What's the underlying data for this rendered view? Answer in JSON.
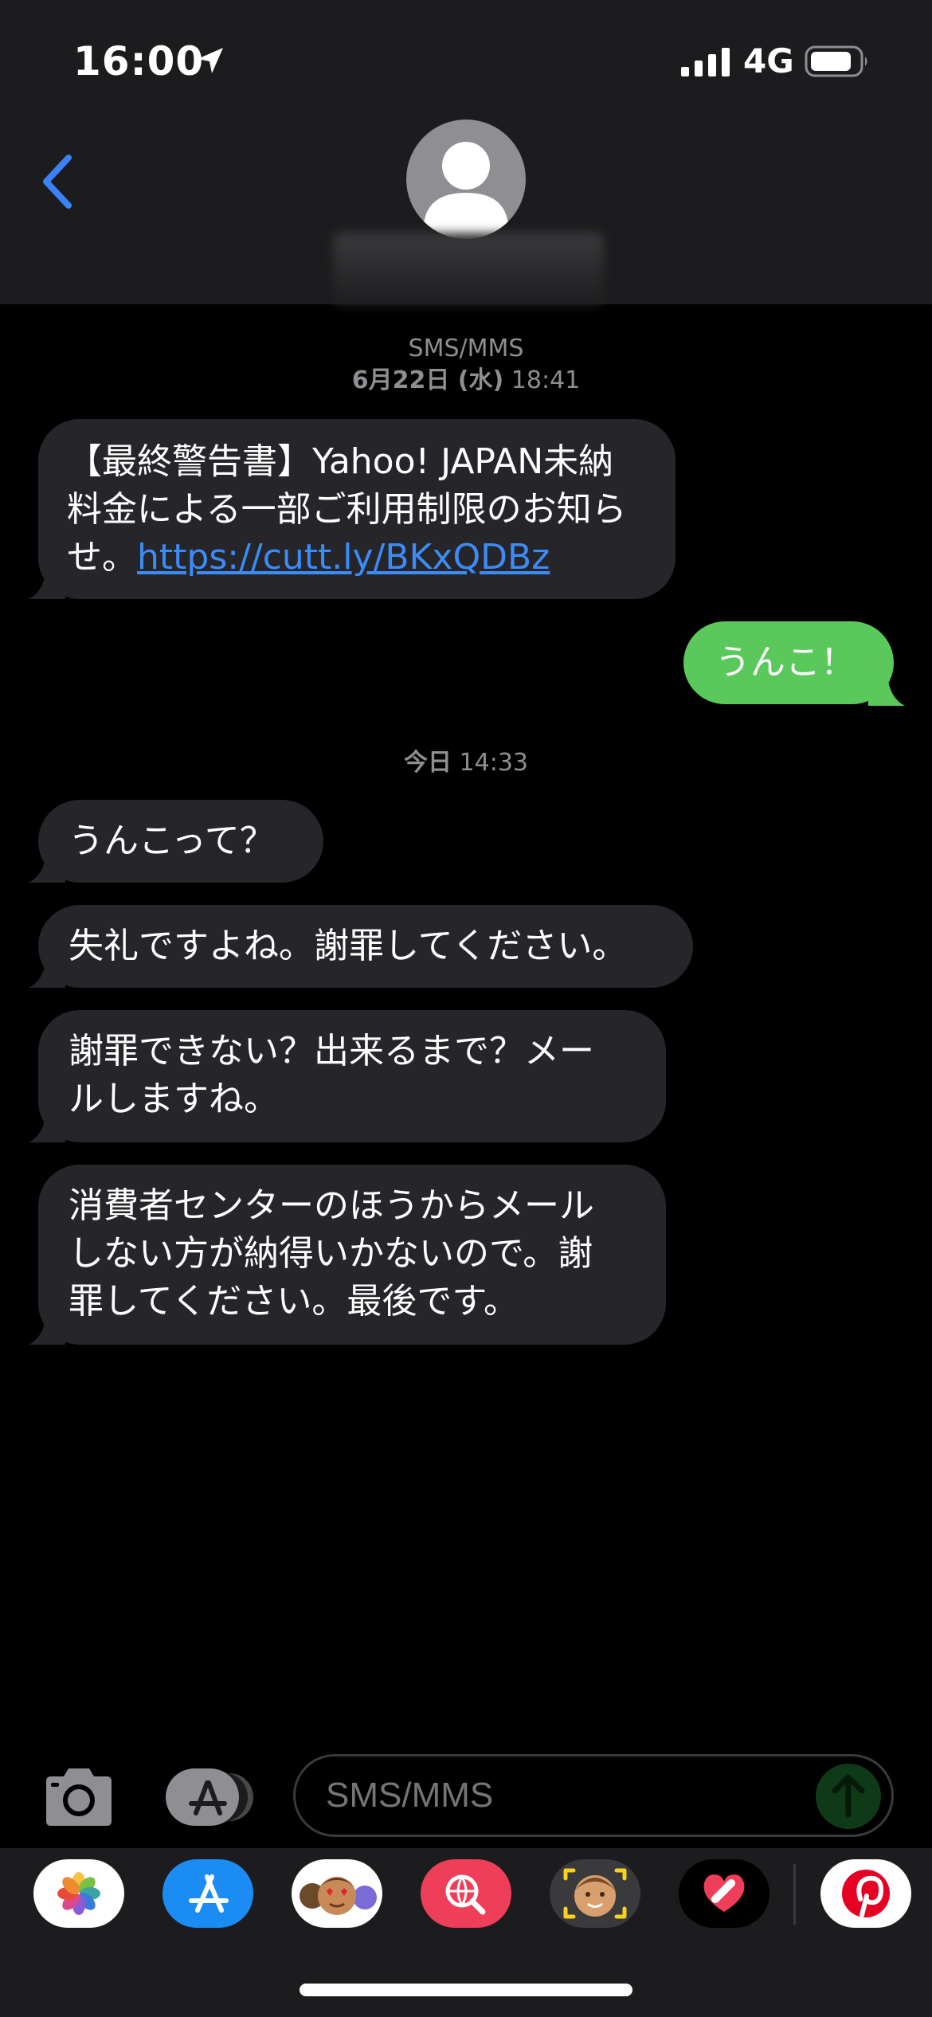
{
  "status_bar": {
    "time": "16:00",
    "network": "4G"
  },
  "conversation": {
    "channel_label": "SMS/MMS",
    "first_timestamp": {
      "date": "6月22日 (水)",
      "time": "18:41"
    },
    "messages_block1": [
      {
        "direction": "incoming",
        "text": "【最終警告書】Yahoo! JAPAN未納料金による一部ご利用制限のお知らせ。",
        "link": "https://cutt.ly/BKxQDBz"
      },
      {
        "direction": "outgoing",
        "text": "うんこ！"
      }
    ],
    "second_timestamp": {
      "date": "今日",
      "time": "14:33"
    },
    "messages_block2": [
      {
        "direction": "incoming",
        "text": "うんこって？"
      },
      {
        "direction": "incoming",
        "text": "失礼ですよね。謝罪してください。"
      },
      {
        "direction": "incoming",
        "line1": "謝罪できない？出来るまで？メー",
        "line2": "ルしますね。"
      },
      {
        "direction": "incoming",
        "line1": "消費者センターのほうからメール",
        "line2": "しない方が納得いかないので。謝",
        "line3": "罪してください。最後です。"
      }
    ]
  },
  "composer": {
    "placeholder": "SMS/MMS"
  },
  "app_drawer": {
    "apps": [
      "photos-app",
      "app-store-app",
      "memoji-stickers-app",
      "web-search-app",
      "memoji-camera-app",
      "digital-touch-app",
      "pinterest-app"
    ]
  },
  "colors": {
    "header_bg": "#1c1c1e",
    "incoming_bubble": "#26252a",
    "outgoing_bubble": "#5ac85a",
    "link": "#3b8cf7",
    "back_chevron": "#3b82f6"
  }
}
